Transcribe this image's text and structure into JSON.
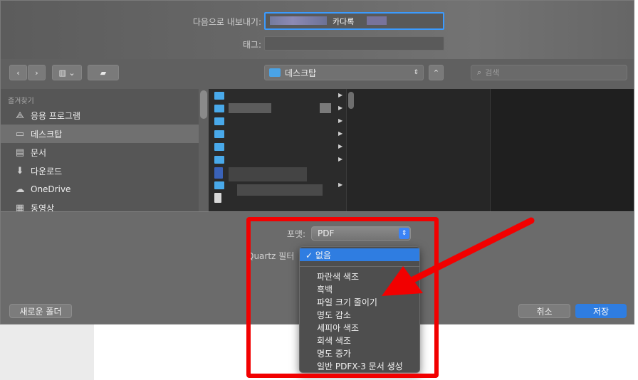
{
  "export": {
    "label": "다음으로 내보내기:",
    "value_visible": "카다록"
  },
  "tags": {
    "label": "태그:"
  },
  "toolbar": {
    "location": "데스크탑",
    "search_placeholder": "검색"
  },
  "sidebar": {
    "header": "즐겨찾기",
    "items": [
      {
        "label": "응용 프로그램",
        "icon": "applications-icon"
      },
      {
        "label": "데스크탑",
        "icon": "desktop-icon",
        "selected": true
      },
      {
        "label": "문서",
        "icon": "document-icon"
      },
      {
        "label": "다운로드",
        "icon": "download-icon"
      },
      {
        "label": "OneDrive",
        "icon": "cloud-icon"
      },
      {
        "label": "동영상",
        "icon": "film-icon"
      }
    ]
  },
  "format": {
    "label": "포맷:",
    "value": "PDF"
  },
  "quartz": {
    "label": "Quartz 필터"
  },
  "filter_menu": {
    "selected": "✓ 없음",
    "options": [
      "파란색 색조",
      "흑백",
      "파일 크기 줄이기",
      "명도 감소",
      "세피아 색조",
      "회색 색조",
      "명도 증가",
      "일반 PDFX-3 문서 생성"
    ]
  },
  "buttons": {
    "new_folder": "새로운 폴더",
    "cancel": "취소",
    "save": "저장"
  },
  "colors": {
    "accent": "#2f7de1",
    "highlight": "#f20000"
  }
}
